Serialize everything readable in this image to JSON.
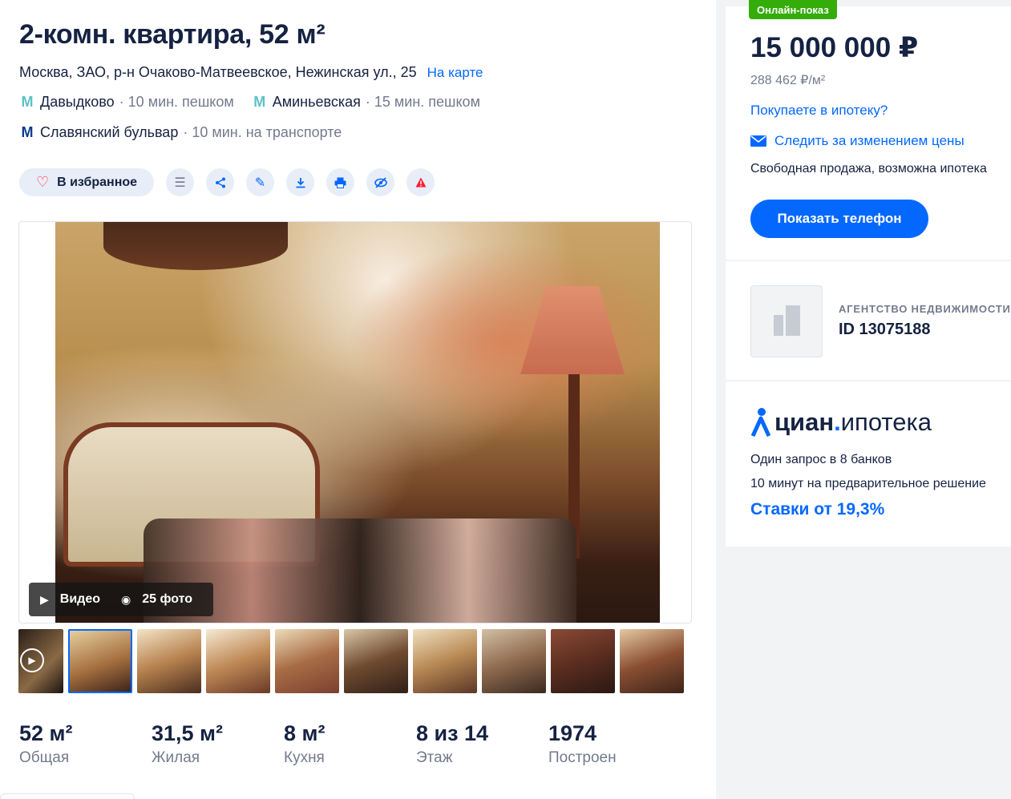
{
  "listing": {
    "title": "2-комн. квартира, 52 м²",
    "address": "Москва, ЗАО, р-н Очаково-Матвеевское, Нежинская ул., 25",
    "map_link": "На карте",
    "metro": [
      {
        "symbol": "М",
        "name": "Давыдково",
        "time": "· 10 мин. пешком",
        "color": "#5dc0c9"
      },
      {
        "symbol": "М",
        "name": "Аминьевская",
        "time": "· 15 мин. пешком",
        "color": "#5dc0c9"
      },
      {
        "symbol": "М",
        "name": "Славянский бульвар",
        "time": "· 10 мин. на транспорте",
        "color": "#0a3d91"
      }
    ]
  },
  "actions": {
    "favorite_label": "В избранное",
    "icons": [
      "add-to-list-icon",
      "share-icon",
      "edit-icon",
      "download-icon",
      "print-icon",
      "hide-icon",
      "report-icon"
    ]
  },
  "gallery": {
    "video_label": "Видео",
    "photos_label": "25 фото",
    "thumbnail_count": 10
  },
  "specs": [
    {
      "value": "52 м²",
      "label": "Общая"
    },
    {
      "value": "31,5 м²",
      "label": "Жилая"
    },
    {
      "value": "8 м²",
      "label": "Кухня"
    },
    {
      "value": "8 из 14",
      "label": "Этаж"
    },
    {
      "value": "1974",
      "label": "Построен"
    }
  ],
  "sidebar": {
    "badge": "Онлайн-показ",
    "price": "15 000 000 ₽",
    "price_per_m2": "288 462 ₽/м²",
    "mortgage_question": "Покупаете в ипотеку?",
    "follow_price": "Следить за изменением цены",
    "sale_type": "Свободная продажа, возможна ипотека",
    "show_phone": "Показать телефон",
    "agency_type": "АГЕНТСТВО НЕДВИЖИМОСТИ",
    "agency_id": "ID 13075188",
    "cian_word1": "циан",
    "cian_dot": ".",
    "cian_word2": "ипотека",
    "cian_line1": "Один запрос в 8 банков",
    "cian_line2": "10 минут на предварительное решение",
    "rates": "Ставки от 19,3%"
  },
  "colors": {
    "accent": "#0468ff",
    "badge_green": "#34ac0a",
    "text_main": "#152242",
    "text_muted": "#737a8e"
  }
}
